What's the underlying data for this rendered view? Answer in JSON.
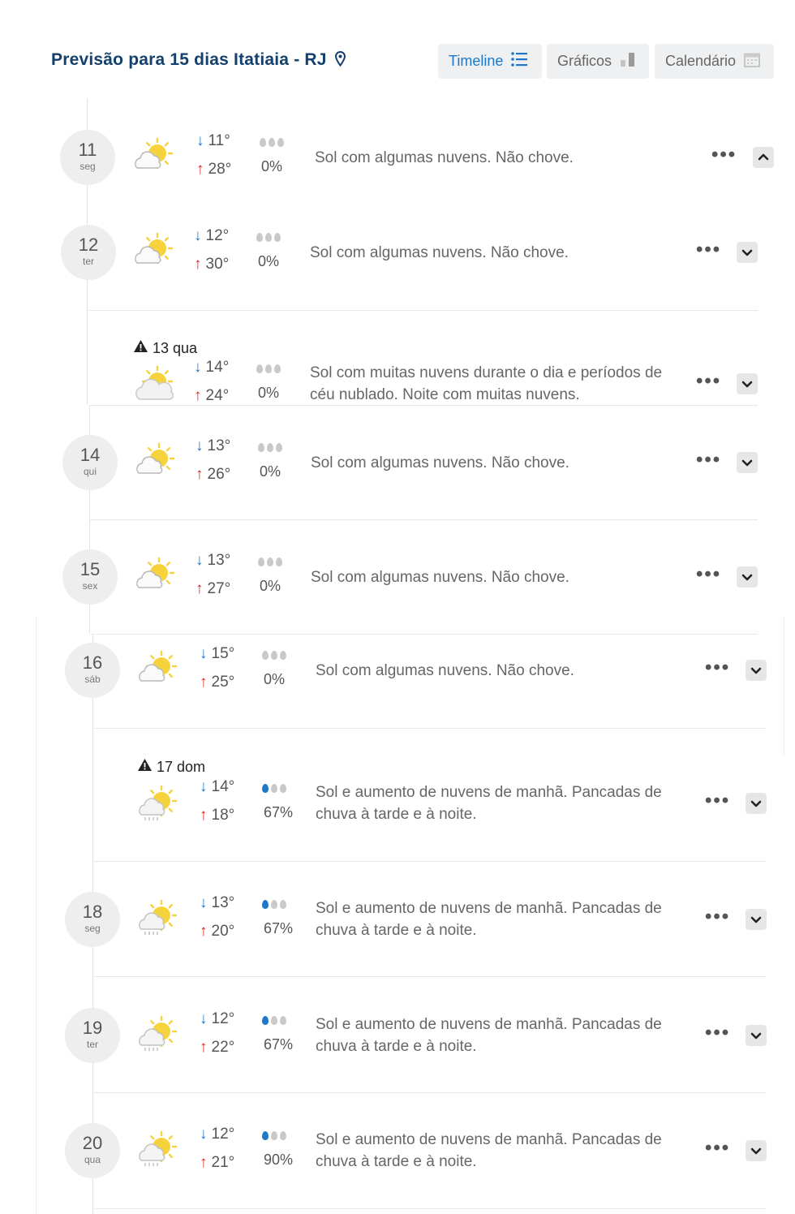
{
  "header": {
    "title": "Previsão para 15 dias Itatiaia - RJ",
    "views": [
      {
        "label": "Timeline",
        "icon": "list-icon",
        "active": true
      },
      {
        "label": "Gráficos",
        "icon": "bar-chart-icon",
        "active": false
      },
      {
        "label": "Calendário",
        "icon": "calendar-icon",
        "active": false
      }
    ]
  },
  "colors": {
    "title": "#14406e",
    "accent": "#1e78c8",
    "max_arrow": "#d9261c",
    "sun": "#f6d33c"
  },
  "days": [
    {
      "day": "11",
      "weekday": "seg",
      "alert": false,
      "icon": "sun-cloud-icon",
      "min": "11°",
      "max": "28°",
      "drops_filled": 0,
      "rain": "0%",
      "desc": "Sol com algumas nuvens. Não chove.",
      "expanded": true
    },
    {
      "day": "12",
      "weekday": "ter",
      "alert": false,
      "icon": "sun-cloud-icon",
      "min": "12°",
      "max": "30°",
      "drops_filled": 0,
      "rain": "0%",
      "desc": "Sol com algumas nuvens. Não chove.",
      "expanded": false
    },
    {
      "day": "13 qua",
      "weekday": "",
      "alert": true,
      "icon": "cloud-sun-icon",
      "min": "14°",
      "max": "24°",
      "drops_filled": 0,
      "rain": "0%",
      "desc": "Sol com muitas nuvens durante o dia e períodos de céu nublado. Noite com muitas nuvens.",
      "expanded": false
    },
    {
      "day": "14",
      "weekday": "qui",
      "alert": false,
      "icon": "sun-cloud-icon",
      "min": "13°",
      "max": "26°",
      "drops_filled": 0,
      "rain": "0%",
      "desc": "Sol com algumas nuvens. Não chove.",
      "expanded": false
    },
    {
      "day": "15",
      "weekday": "sex",
      "alert": false,
      "icon": "sun-cloud-icon",
      "min": "13°",
      "max": "27°",
      "drops_filled": 0,
      "rain": "0%",
      "desc": "Sol com algumas nuvens. Não chove.",
      "expanded": false
    },
    {
      "day": "16",
      "weekday": "sáb",
      "alert": false,
      "icon": "sun-cloud-icon",
      "min": "15°",
      "max": "25°",
      "drops_filled": 0,
      "rain": "0%",
      "desc": "Sol com algumas nuvens. Não chove.",
      "expanded": false
    },
    {
      "day": "17 dom",
      "weekday": "",
      "alert": true,
      "icon": "sun-rain-icon",
      "min": "14°",
      "max": "18°",
      "drops_filled": 1,
      "rain": "67%",
      "desc": "Sol e aumento de nuvens de manhã. Pancadas de chuva à tarde e à noite.",
      "expanded": false
    },
    {
      "day": "18",
      "weekday": "seg",
      "alert": false,
      "icon": "sun-rain-icon",
      "min": "13°",
      "max": "20°",
      "drops_filled": 1,
      "rain": "67%",
      "desc": "Sol e aumento de nuvens de manhã. Pancadas de chuva à tarde e à noite.",
      "expanded": false
    },
    {
      "day": "19",
      "weekday": "ter",
      "alert": false,
      "icon": "sun-rain-icon",
      "min": "12°",
      "max": "22°",
      "drops_filled": 1,
      "rain": "67%",
      "desc": "Sol e aumento de nuvens de manhã. Pancadas de chuva à tarde e à noite.",
      "expanded": false
    },
    {
      "day": "20",
      "weekday": "qua",
      "alert": false,
      "icon": "sun-rain-icon",
      "min": "12°",
      "max": "21°",
      "drops_filled": 1,
      "rain": "90%",
      "desc": "Sol e aumento de nuvens de manhã. Pancadas de chuva à tarde e à noite.",
      "expanded": false
    }
  ]
}
